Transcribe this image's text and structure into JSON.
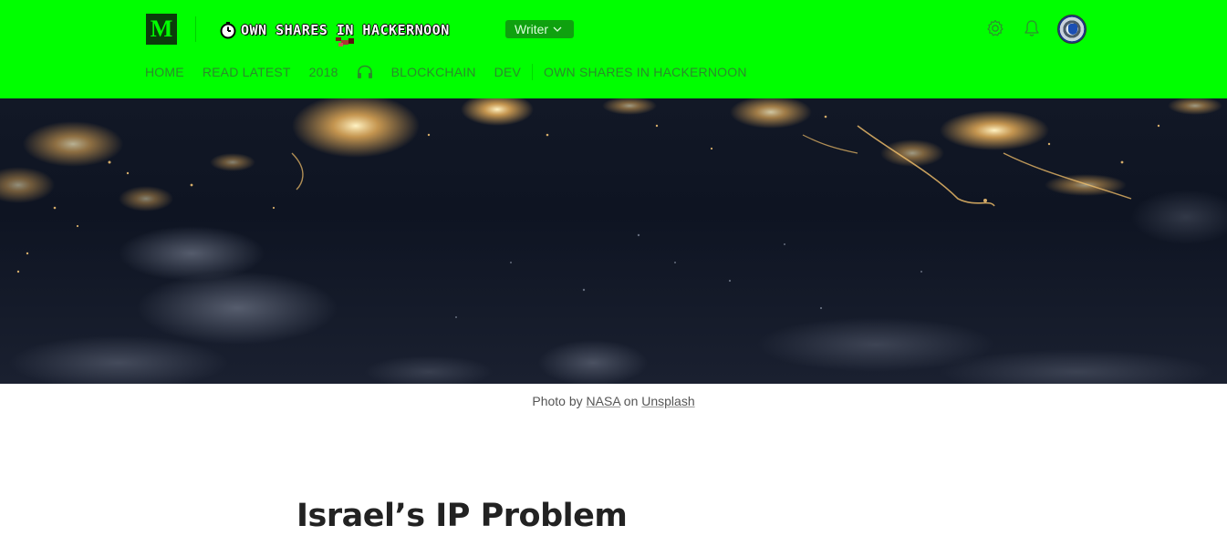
{
  "header": {
    "logo_letter": "M",
    "publication_name": "OWN SHARES IN HACKERNOON",
    "writer_label": "Writer",
    "icons": [
      "settings-icon",
      "bell-icon",
      "avatar"
    ],
    "background_color": "#00ff00"
  },
  "nav": {
    "items": [
      "HOME",
      "READ LATEST",
      "2018",
      "BLOCKCHAIN",
      "DEV",
      "OWN SHARES IN HACKERNOON"
    ],
    "icon": "headphones-icon"
  },
  "hero": {
    "caption_prefix": "Photo by",
    "caption_author": "NASA",
    "caption_mid": "on",
    "caption_source": "Unsplash"
  },
  "article": {
    "title": "Israel’s IP Problem"
  }
}
